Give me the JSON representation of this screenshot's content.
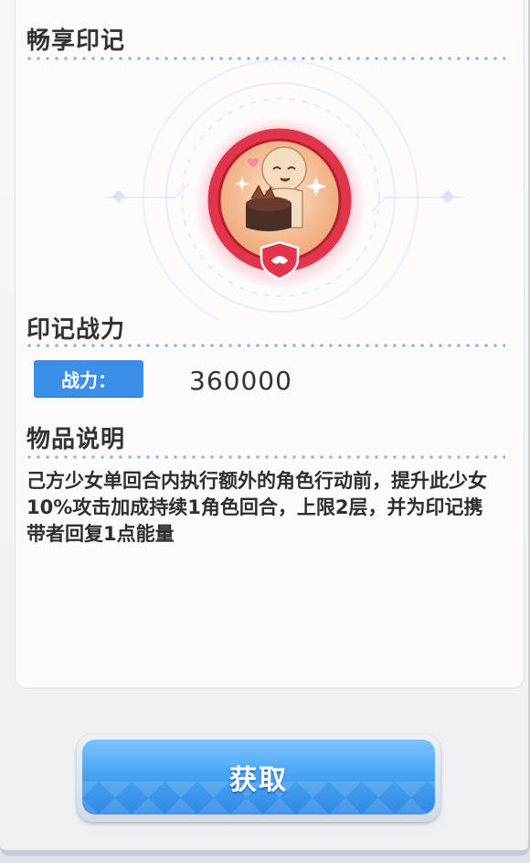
{
  "panel": {
    "title": "畅享印记",
    "power_section_title": "印记战力",
    "power_label": "战力：",
    "power_value": "360000",
    "description_title": "物品说明",
    "description": "己方少女单回合内执行额外的角色行动前，提升此少女10%攻击加成持续1角色回合，上限2层，并为印记携带者回复1点能量"
  },
  "badge": {
    "icon": "character-eating-cake-emblem",
    "ring_color": "#e0354a",
    "inner_color": "#f6c79e"
  },
  "action": {
    "obtain_label": "获取"
  },
  "colors": {
    "accent": "#3b8fe6",
    "dots": "#8fb6ee",
    "text": "#333333"
  }
}
